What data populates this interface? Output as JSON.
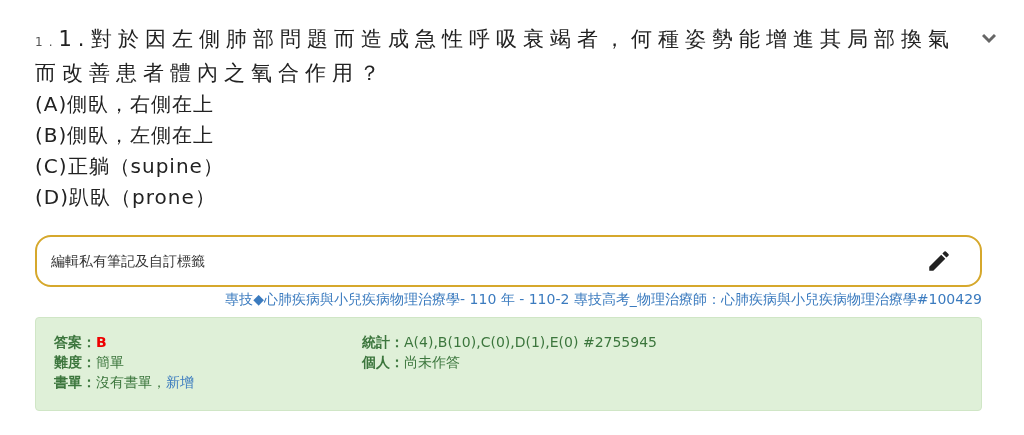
{
  "question": {
    "index": "1.",
    "number": "1.",
    "text": "對於因左側肺部問題而造成急性呼吸衰竭者，何種姿勢能增進其局部換氣而改善患者體內之氧合作用？"
  },
  "options": [
    "(A)側臥，右側在上",
    "(B)側臥，左側在上",
    "(C)正躺（supine）",
    "(D)趴臥（prone）"
  ],
  "note_field": {
    "placeholder": "編輯私有筆記及自訂標籤"
  },
  "source_link": "專技◆心肺疾病與小兒疾病物理治療學- 110 年 - 110-2 專技高考_物理治療師：心肺疾病與小兒疾病物理治療學#100429",
  "answer_panel": {
    "left": [
      {
        "kind": "answer",
        "label": "答案：",
        "value": "B"
      },
      {
        "kind": "plain",
        "label": "難度：",
        "value": "簡單"
      },
      {
        "kind": "link",
        "label": "書單：",
        "value": "沒有書單，",
        "link": "新增"
      }
    ],
    "right": [
      {
        "kind": "plain",
        "label": "統計：",
        "value": "A(4),B(10),C(0),D(1),E(0) #2755945"
      },
      {
        "kind": "plain",
        "label": "個人：",
        "value": "尚未作答"
      }
    ]
  }
}
